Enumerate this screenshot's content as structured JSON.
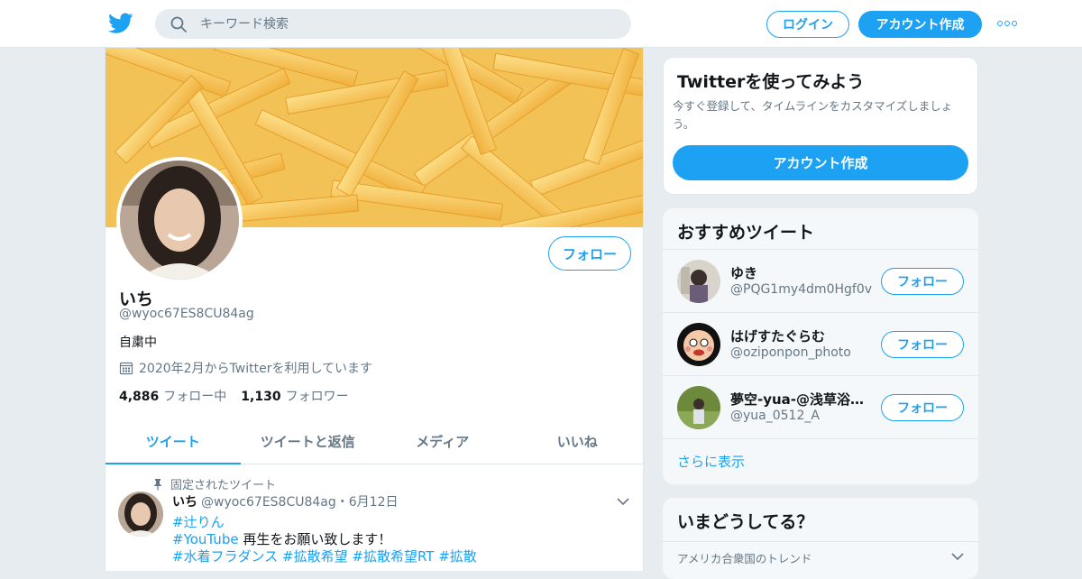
{
  "header": {
    "search_placeholder": "キーワード検索",
    "login_label": "ログイン",
    "signup_label": "アカウント作成"
  },
  "profile": {
    "follow_label": "フォロー",
    "name": "いち",
    "handle": "@wyoc67ES8CU84ag",
    "bio": "自粛中",
    "joined": "2020年2月からTwitterを利用しています",
    "following_count": "4,886",
    "following_label": "フォロー中",
    "followers_count": "1,130",
    "followers_label": "フォロワー",
    "tabs": [
      {
        "label": "ツイート"
      },
      {
        "label": "ツイートと返信"
      },
      {
        "label": "メディア"
      },
      {
        "label": "いいね"
      }
    ]
  },
  "pinned_tweet": {
    "pinned_label": "固定されたツイート",
    "name": "いち",
    "handle_date": "@wyoc67ES8CU84ag・6月12日",
    "line1": "#辻りん",
    "line2_tag": "#YouTube",
    "line2_text": " 再生をお願い致します！",
    "line3": "#水着フラダンス #拡散希望 #拡散希望RT #拡散"
  },
  "sidebar": {
    "try_title": "Twitterを使ってみよう",
    "try_text": "今すぐ登録して、タイムラインをカスタマイズしましょう。",
    "try_button": "アカウント作成",
    "rec_title": "おすすめツイート",
    "rec_users": [
      {
        "name": "ゆき",
        "handle": "@PQG1my4dm0Hgf0v",
        "follow": "フォロー"
      },
      {
        "name": "はげすたぐらむ",
        "handle": "@oziponpon_photo",
        "follow": "フォロー"
      },
      {
        "name": "夢空-yua-@浅草浴衣...",
        "handle": "@yua_0512_A",
        "follow": "フォロー"
      }
    ],
    "more_label": "さらに表示",
    "trend_title": "いまどうしてる？",
    "trend_sub": "アメリカ合衆国のトレンド"
  }
}
